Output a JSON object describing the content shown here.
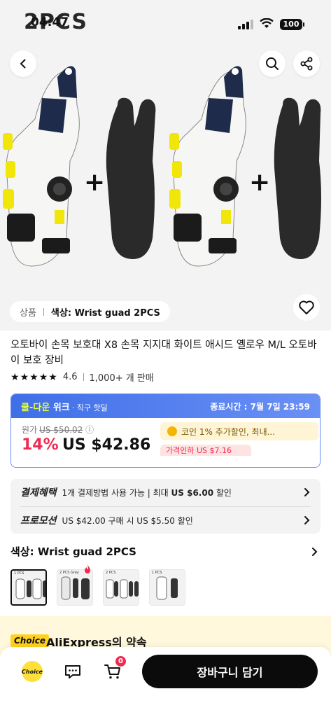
{
  "status": {
    "time": "04:47",
    "overlay_text": "2PCS",
    "battery": "100"
  },
  "gallery": {
    "crumb_label": "상품",
    "crumb_value": "색상: Wrist guad 2PCS"
  },
  "product": {
    "title": "오토바이 손목 보호대 X8 손목 지지대 화이트 애시드 옐로우 M/L 오토바이 보호 장비",
    "rating": "4.6",
    "sold": "1,000+ 개 판매"
  },
  "deal": {
    "brand_a": "쿨-다운",
    "brand_b": "위크",
    "brand_sub": "· 직구 핫딜",
    "end_time": "종료시간 : 7월 7일 23:59",
    "orig_label": "원가",
    "orig_price": "US $50.02",
    "discount": "14%",
    "price": "US $42.86",
    "coupon": "코인 1% 추가할인, 최내...",
    "coupon_tag": "가격인하 US $7.16"
  },
  "benefits": {
    "payment_label": "결제혜택",
    "payment_pre": "1개 결제방법 사용 가능 | 최대 ",
    "payment_amount": "US $6.00",
    "payment_post": " 할인",
    "promo_label": "프로모션",
    "promo_text": "US $42.00 구매 시 US $5.50 할인"
  },
  "color": {
    "title": "색상: Wrist guad 2PCS",
    "thumbs": [
      "1 PCS",
      "2 PCS Grey",
      "2 PCS",
      "1 PCS"
    ]
  },
  "choice": {
    "badge": "Choice",
    "promise": "AliExpress의 약속"
  },
  "bottom": {
    "choice_icon": "Choice",
    "cart_count": "0",
    "add_to_cart": "장바구니 담기"
  },
  "colors": {
    "accent_red": "#f02b52",
    "deal_blue": "#3f6fe8",
    "choice_yellow": "#ffd21f"
  }
}
